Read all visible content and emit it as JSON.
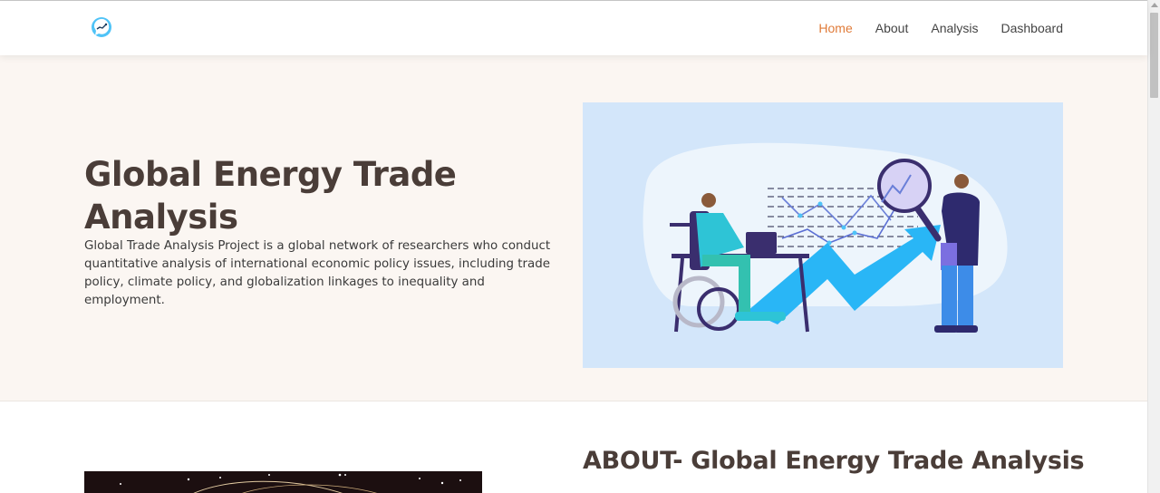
{
  "nav": {
    "logo_icon": "chat-bubble-chart-icon",
    "links": [
      {
        "label": "Home",
        "active": true
      },
      {
        "label": "About",
        "active": false
      },
      {
        "label": "Analysis",
        "active": false
      },
      {
        "label": "Dashboard",
        "active": false
      }
    ]
  },
  "hero": {
    "title": "Global Energy Trade Analysis",
    "description": "Global Trade Analysis Project is a global network of researchers who conduct quantitative analysis of international economic policy issues, including trade policy, climate policy, and globalization linkages to inequality and employment.",
    "illustration": "data-analysis-illustration"
  },
  "about": {
    "title": "ABOUT- Global Energy Trade Analysis",
    "image": "dark-starfield-image"
  },
  "colors": {
    "accent": "#e07b39",
    "heading": "#4a3d38",
    "hero_bg": "#fbf6f2",
    "illustration_bg": "#d3e6fa"
  }
}
